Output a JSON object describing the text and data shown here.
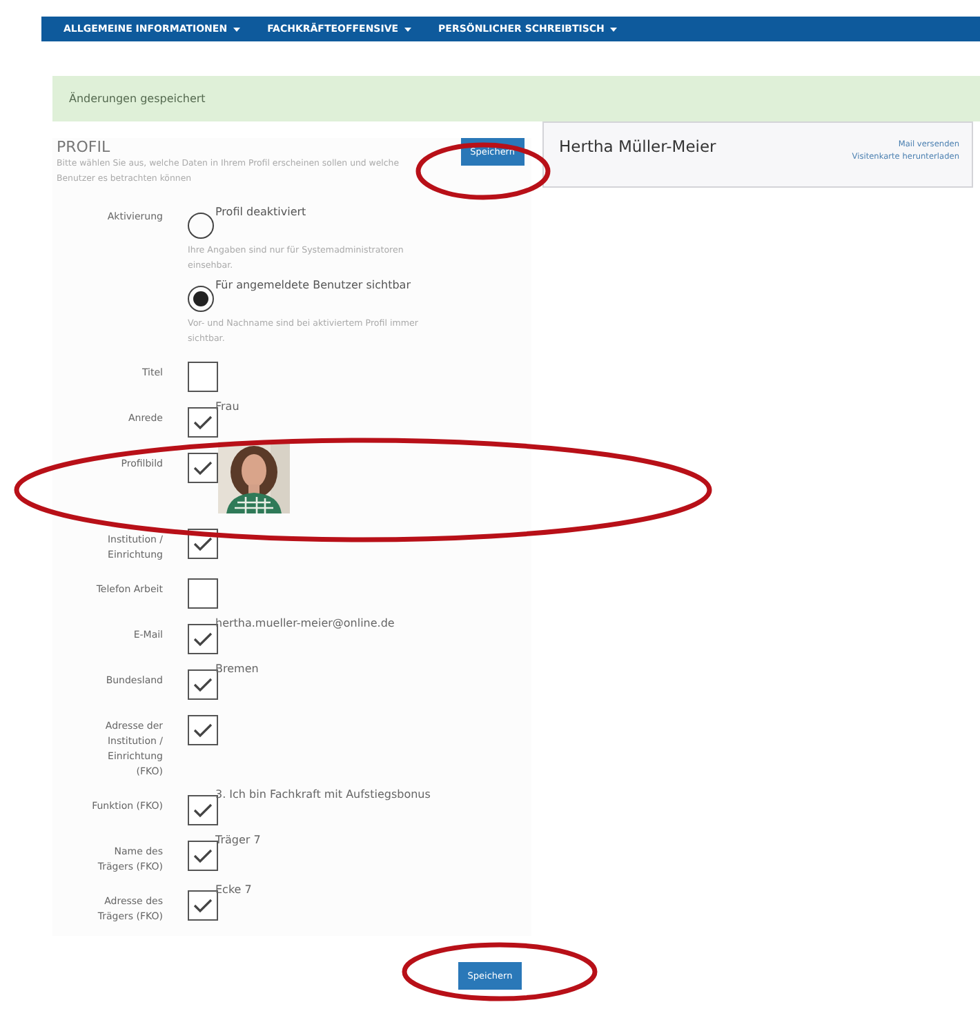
{
  "nav": {
    "items": [
      {
        "label": "ALLGEMEINE INFORMATIONEN"
      },
      {
        "label": "FACHKRÄFTEOFFENSIVE"
      },
      {
        "label": "PERSÖNLICHER SCHREIBTISCH"
      }
    ]
  },
  "banner": {
    "text": "Änderungen gespeichert"
  },
  "profile": {
    "title": "PROFIL",
    "description": "Bitte wählen Sie aus, welche Daten in Ihrem Profil erscheinen sollen und welche Benutzer es betrachten können",
    "save_button": "Speichern"
  },
  "card": {
    "name": "Hertha Müller-Meier",
    "links": [
      "Mail versenden",
      "Visitenkarte herunterladen"
    ]
  },
  "activation": {
    "label": "Aktivierung",
    "options": [
      {
        "label": "Profil deaktiviert",
        "hint": "Ihre Angaben sind nur für Systemadministratoren einsehbar.",
        "selected": false
      },
      {
        "label": "Für angemeldete Benutzer sichtbar",
        "hint": "Vor- und Nachname sind bei aktiviertem Profil immer sichtbar.",
        "selected": true
      }
    ]
  },
  "fields": [
    {
      "kind": "text",
      "label": "Titel",
      "checked": false
    },
    {
      "kind": "text",
      "label": "Anrede",
      "checked": true,
      "value": "Frau"
    },
    {
      "kind": "picture",
      "label": "Profilbild",
      "checked": true
    },
    {
      "kind": "text",
      "label": "Institution / Einrichtung",
      "checked": true
    },
    {
      "kind": "text",
      "label": "Telefon Arbeit",
      "checked": false
    },
    {
      "kind": "text",
      "label": "E-Mail",
      "checked": true,
      "value": "hertha.mueller-meier@online.de"
    },
    {
      "kind": "text",
      "label": "Bundesland",
      "checked": true,
      "value": "Bremen"
    },
    {
      "kind": "text",
      "label": "Adresse der Institution / Einrichtung (FKO)",
      "checked": true
    },
    {
      "kind": "text",
      "label": "Funktion (FKO)",
      "checked": true,
      "value": "3. Ich bin Fachkraft mit Aufstiegsbonus"
    },
    {
      "kind": "text",
      "label": "Name des Trägers (FKO)",
      "checked": true,
      "value": "Träger 7"
    },
    {
      "kind": "text",
      "label": "Adresse des Trägers (FKO)",
      "checked": true,
      "value": "Ecke 7"
    }
  ],
  "bottom_save_button": "Speichern"
}
